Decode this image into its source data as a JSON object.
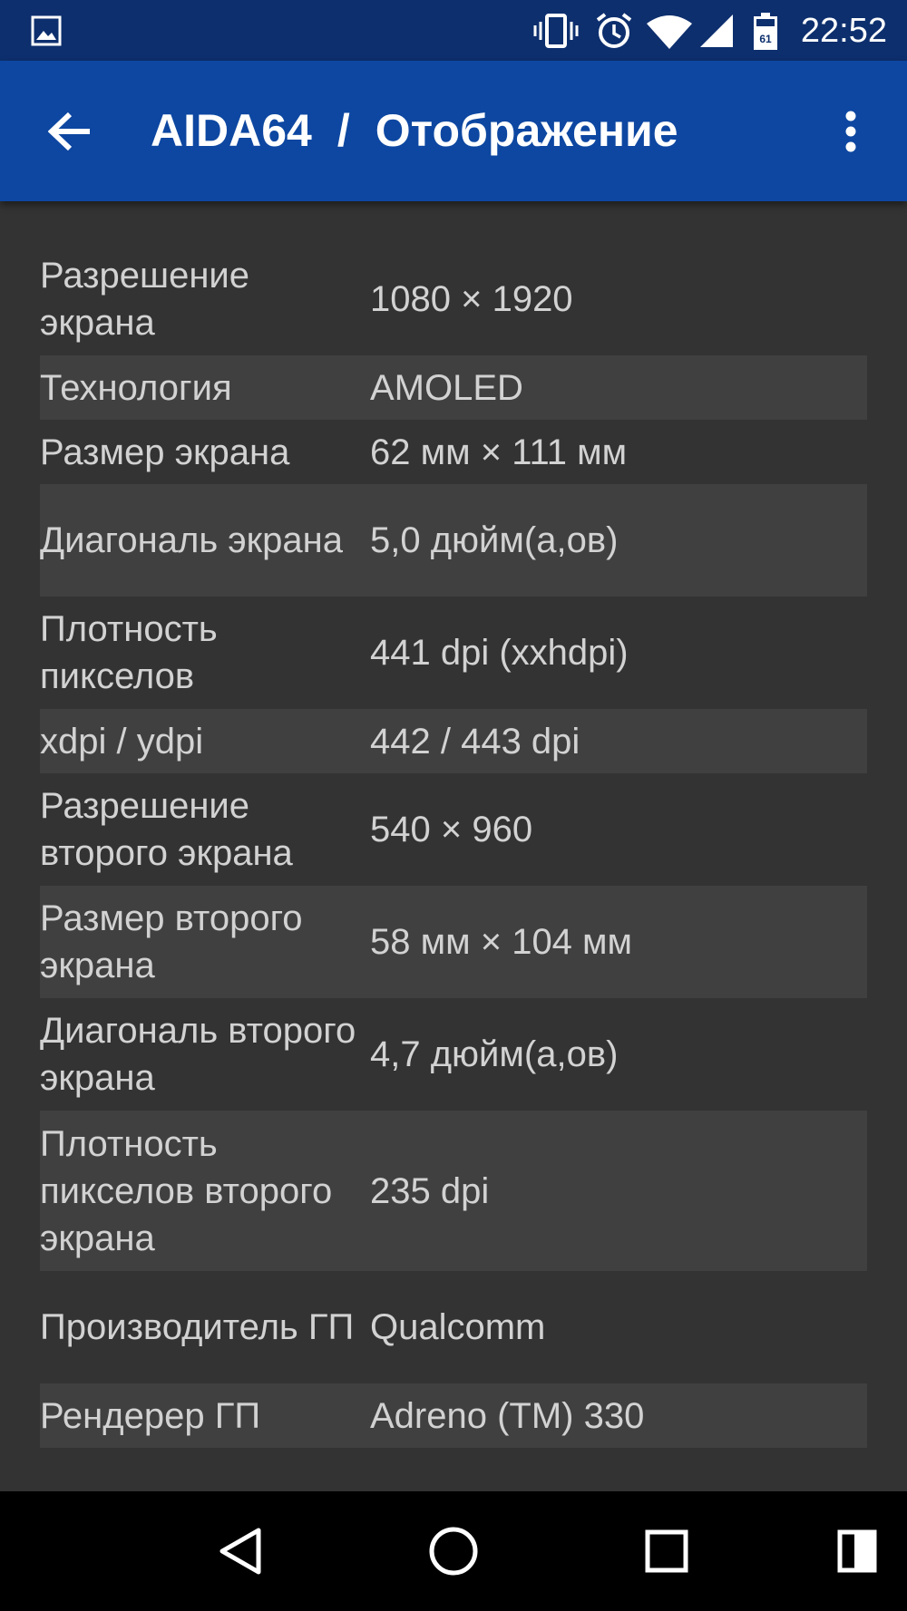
{
  "status_bar": {
    "time": "22:52",
    "icons": [
      "image-icon",
      "vibrate-icon",
      "alarm-icon",
      "wifi-icon",
      "cell-signal-icon",
      "battery-icon"
    ],
    "battery_text": "61"
  },
  "app_bar": {
    "app_name": "AIDA64",
    "separator": "/",
    "section": "Отображение",
    "back_icon": "arrow-back-icon",
    "menu_icon": "more-vert-icon"
  },
  "rows": [
    {
      "label": "Разрешение экрана",
      "value": "1080 × 1920"
    },
    {
      "label": "Технология",
      "value": "AMOLED"
    },
    {
      "label": "Размер экрана",
      "value": "62 мм × 111 мм"
    },
    {
      "label": "Диагональ экрана",
      "value": "5,0 дюйм(а,ов)"
    },
    {
      "label": "Плотность пикселов",
      "value": "441 dpi (xxhdpi)"
    },
    {
      "label": "xdpi / ydpi",
      "value": "442 / 443 dpi"
    },
    {
      "label": "Разрешение второго экрана",
      "value": "540 × 960"
    },
    {
      "label": "Размер второго экрана",
      "value": "58 мм × 104 мм"
    },
    {
      "label": "Диагональ второго экрана",
      "value": "4,7 дюйм(а,ов)"
    },
    {
      "label": "Плотность пикселов второго экрана",
      "value": "235 dpi"
    },
    {
      "label": "Производитель ГП",
      "value": "Qualcomm"
    },
    {
      "label": "Рендерер ГП",
      "value": "Adreno (TM) 330"
    }
  ],
  "nav_bar": {
    "icons": [
      "back-triangle-icon",
      "home-circle-icon",
      "recents-square-icon",
      "secondary-screen-icon"
    ]
  },
  "colors": {
    "status_bar": "#0d2f6e",
    "app_bar": "#0d47a1",
    "background": "#333333",
    "alt_row": "#404040",
    "text": "#d2d2d2"
  }
}
